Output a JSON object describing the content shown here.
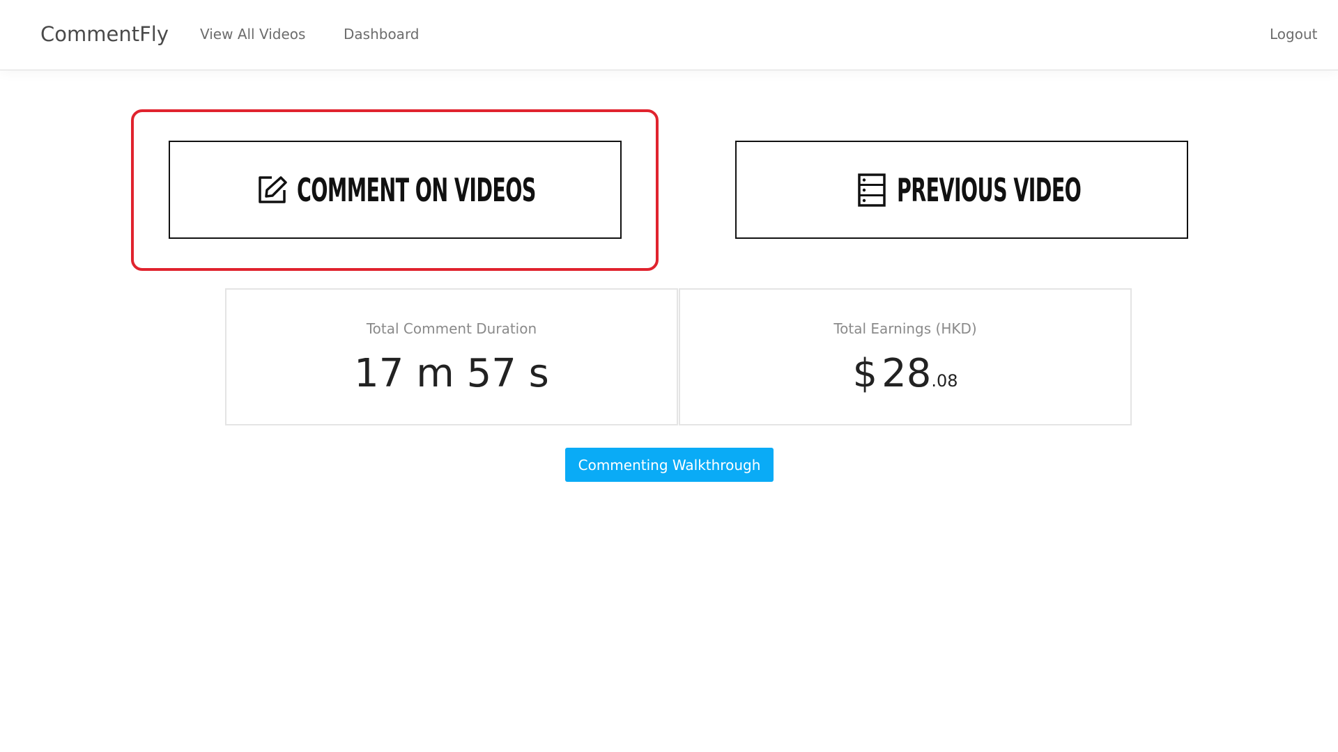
{
  "navbar": {
    "brand": "CommentFly",
    "links": {
      "view_all_videos": "View All Videos",
      "dashboard": "Dashboard",
      "logout": "Logout"
    }
  },
  "actions": {
    "comment": {
      "label": "COMMENT ON VIDEOS",
      "icon": "edit-icon"
    },
    "previous": {
      "label": "PREVIOUS VIDEO",
      "icon": "list-icon"
    }
  },
  "highlight_color": "#e0232e",
  "stats": {
    "duration": {
      "label": "Total Comment Duration",
      "value": "17 m 57 s"
    },
    "earnings": {
      "label": "Total Earnings (HKD)",
      "currency": "$",
      "whole": "28",
      "cents": ".08"
    }
  },
  "walkthrough": {
    "label": "Commenting Walkthrough",
    "color": "#0aabf6"
  }
}
